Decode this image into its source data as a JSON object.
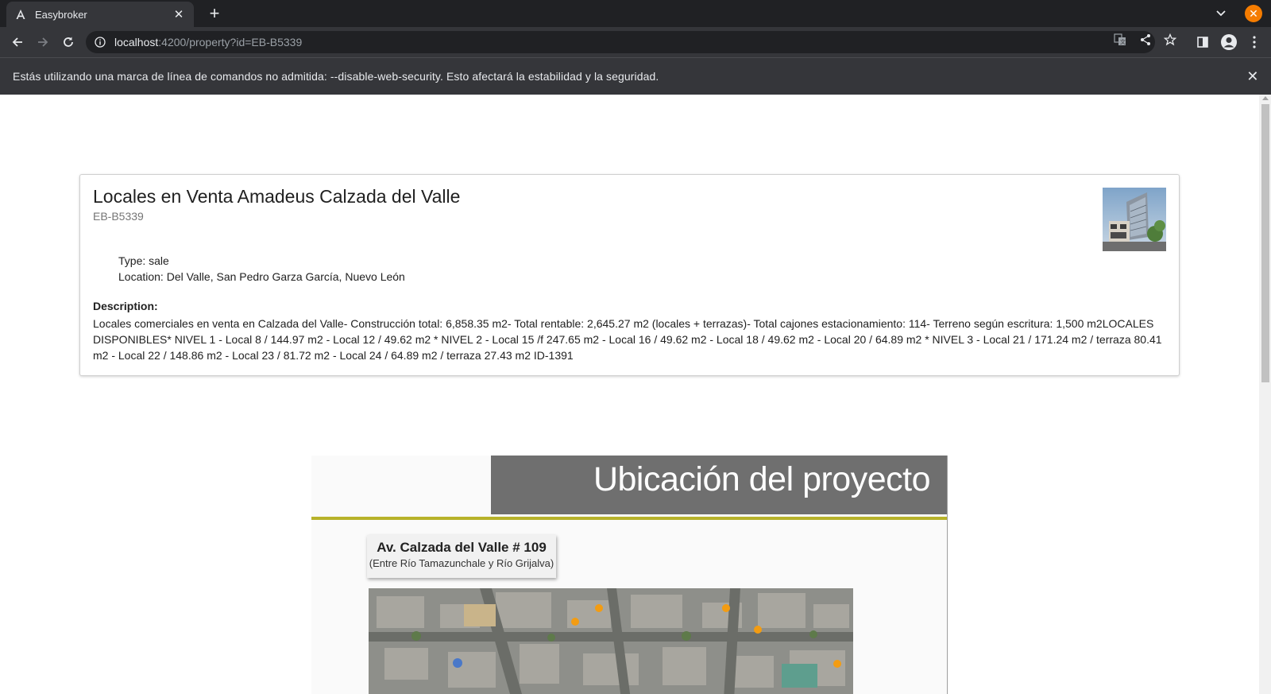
{
  "browser": {
    "tab_title": "Easybroker",
    "url_host": "localhost",
    "url_rest": ":4200/property?id=EB-B5339",
    "infobar_text": "Estás utilizando una marca de línea de comandos no admitida: --disable-web-security. Esto afectará la estabilidad y la seguridad."
  },
  "property": {
    "title": "Locales en Venta Amadeus Calzada del Valle",
    "code": "EB-B5339",
    "type_line": "Type: sale",
    "location_line": "Location: Del Valle, San Pedro Garza García, Nuevo León",
    "description_label": "Description:",
    "description": "Locales comerciales en venta en Calzada del Valle- Construcción total: 6,858.35 m2- Total rentable: 2,645.27 m2 (locales + terrazas)- Total cajones estacionamiento: 114- Terreno según escritura: 1,500 m2LOCALES DISPONIBLES* NIVEL 1 - Local 8 / 144.97 m2 - Local 12 / 49.62 m2 * NIVEL 2 - Local 15 /f 247.65 m2 - Local 16 / 49.62 m2 - Local 18 / 49.62 m2 - Local 20 / 64.89 m2 * NIVEL 3 - Local 21 / 171.24 m2 / terraza 80.41 m2 - Local 22 / 148.86 m2 - Local 23 / 81.72 m2 - Local 24 / 64.89 m2 / terraza 27.43 m2 ID-1391"
  },
  "project_image": {
    "heading": "Ubicación del proyecto",
    "address": "Av. Calzada del Valle # 109",
    "address_sub": "(Entre Río Tamazunchale y Río Grijalva)"
  },
  "colors": {
    "accent_rule": "#b7b22a",
    "header_gray": "#6f6f6f",
    "close_button": "#f57c00"
  }
}
